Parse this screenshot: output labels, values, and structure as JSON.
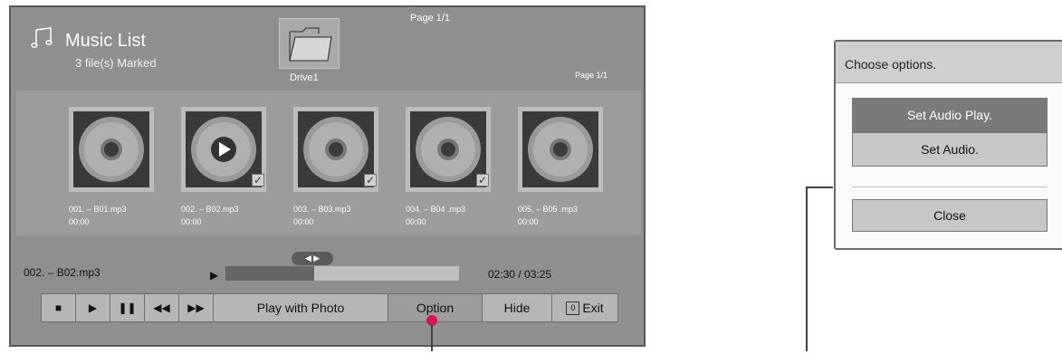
{
  "header": {
    "title": "Music List",
    "subtitle": "3 file(s) Marked",
    "drive_label": "Drive1",
    "page_top": "Page 1/1",
    "page_right": "Page 1/1"
  },
  "files": [
    {
      "name": "001. – B01.mp3",
      "time": "00:00",
      "marked": false,
      "playing": false
    },
    {
      "name": "002. – B02.mp3",
      "time": "00:00",
      "marked": true,
      "playing": true
    },
    {
      "name": "003. – B03.mp3",
      "time": "00:00",
      "marked": true,
      "playing": false
    },
    {
      "name": "004. – B04 .mp3",
      "time": "00:00",
      "marked": true,
      "playing": false
    },
    {
      "name": "005. – B05 .mp3",
      "time": "00:00",
      "marked": false,
      "playing": false
    }
  ],
  "player": {
    "now_playing": "002. – B02.mp3",
    "time": "02:30 / 03:25",
    "progress": 0.38,
    "seek_pill": "◀ ▶"
  },
  "controls": {
    "stop": "■",
    "play": "▶",
    "pause": "❚❚",
    "rewind": "◀◀",
    "forward": "▶▶",
    "play_with_photo": "Play with Photo",
    "option": "Option",
    "hide": "Hide",
    "exit_key": "0",
    "exit": "Exit"
  },
  "dialog": {
    "title": "Choose options.",
    "options": [
      "Set Audio Play.",
      "Set Audio."
    ],
    "close": "Close"
  }
}
